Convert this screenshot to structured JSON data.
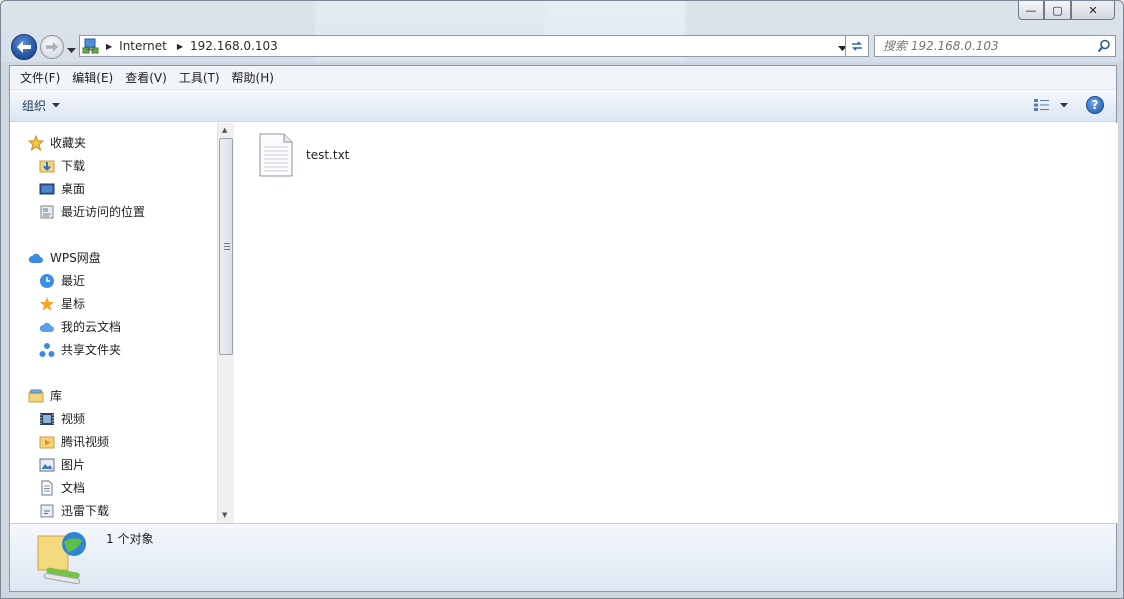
{
  "window": {
    "caption_buttons": {
      "minimize": "—",
      "maximize": "▢",
      "close": "✕"
    }
  },
  "navigation": {
    "back_icon": "back-arrow-icon",
    "forward_icon": "forward-arrow-icon",
    "address": {
      "segments": [
        "Internet",
        "192.168.0.103"
      ],
      "location_icon": "network-location-icon"
    },
    "search": {
      "placeholder": "搜索 192.168.0.103"
    }
  },
  "menubar": {
    "items": [
      "文件(F)",
      "编辑(E)",
      "查看(V)",
      "工具(T)",
      "帮助(H)"
    ]
  },
  "toolbar": {
    "organize_label": "组织",
    "view_icon": "view-options-icon",
    "help_icon": "help-icon"
  },
  "sidebar": {
    "groups": [
      {
        "label": "收藏夹",
        "icon": "favorites-star-icon",
        "items": [
          {
            "label": "下载",
            "icon": "downloads-folder-icon"
          },
          {
            "label": "桌面",
            "icon": "desktop-icon"
          },
          {
            "label": "最近访问的位置",
            "icon": "recent-places-icon"
          }
        ]
      },
      {
        "label": "WPS网盘",
        "icon": "wps-cloud-icon",
        "items": [
          {
            "label": "最近",
            "icon": "clock-icon"
          },
          {
            "label": "星标",
            "icon": "star-icon"
          },
          {
            "label": "我的云文档",
            "icon": "cloud-docs-icon"
          },
          {
            "label": "共享文件夹",
            "icon": "shared-folder-icon"
          }
        ]
      },
      {
        "label": "库",
        "icon": "libraries-icon",
        "items": [
          {
            "label": "视频",
            "icon": "video-library-icon"
          },
          {
            "label": "腾讯视频",
            "icon": "tencent-video-icon"
          },
          {
            "label": "图片",
            "icon": "pictures-library-icon"
          },
          {
            "label": "文档",
            "icon": "documents-library-icon"
          },
          {
            "label": "迅雷下载",
            "icon": "thunder-download-icon"
          }
        ]
      }
    ]
  },
  "content": {
    "files": [
      {
        "name": "test.txt",
        "icon": "text-file-icon"
      }
    ]
  },
  "details": {
    "count_text": "1 个对象",
    "icon": "network-share-icon"
  }
}
